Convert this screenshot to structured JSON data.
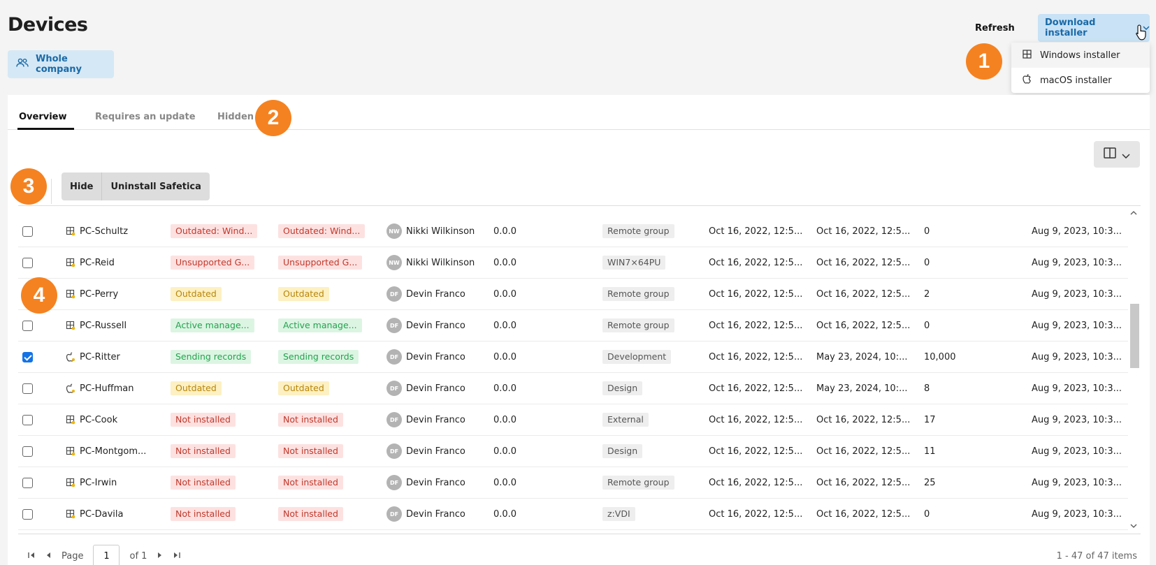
{
  "header": {
    "title": "Devices",
    "scope_label": "Whole company",
    "refresh_label": "Refresh",
    "download_label": "Download installer"
  },
  "download_menu": [
    {
      "label": "Windows installer",
      "icon": "windows-icon"
    },
    {
      "label": "macOS installer",
      "icon": "apple-icon"
    }
  ],
  "markers": [
    "1",
    "2",
    "3",
    "4"
  ],
  "tabs": [
    {
      "label": "Overview",
      "active": true
    },
    {
      "label": "Requires an update",
      "active": false
    },
    {
      "label": "Hidden",
      "active": false
    }
  ],
  "bulk_actions": {
    "hide_label": "Hide",
    "uninstall_label": "Uninstall Safetica"
  },
  "rows": [
    {
      "checked": false,
      "os": "windows",
      "name": "PC-Schultz",
      "status1": "Outdated: Wind...",
      "status2": "Outdated: Wind...",
      "status_color": "red",
      "user_initials": "NW",
      "user": "Nikki Wilkinson",
      "version": "0.0.0",
      "group": "Remote group",
      "date1": "Oct 16, 2022, 12:5...",
      "date2": "Oct 16, 2022, 12:5...",
      "count": "0",
      "date3": "Aug 9, 2023, 10:3..."
    },
    {
      "checked": false,
      "os": "windows",
      "name": "PC-Reid",
      "status1": "Unsupported G...",
      "status2": "Unsupported G...",
      "status_color": "red",
      "user_initials": "NW",
      "user": "Nikki Wilkinson",
      "version": "0.0.0",
      "group": "WIN7×64PU",
      "date1": "Oct 16, 2022, 12:5...",
      "date2": "Oct 16, 2022, 12:5...",
      "count": "0",
      "date3": "Aug 9, 2023, 10:3..."
    },
    {
      "checked": false,
      "os": "windows",
      "name": "PC-Perry",
      "status1": "Outdated",
      "status2": "Outdated",
      "status_color": "yellow",
      "user_initials": "DF",
      "user": "Devin Franco",
      "version": "0.0.0",
      "group": "Remote group",
      "date1": "Oct 16, 2022, 12:5...",
      "date2": "Oct 16, 2022, 12:5...",
      "count": "2",
      "date3": "Aug 9, 2023, 10:3..."
    },
    {
      "checked": false,
      "os": "windows",
      "name": "PC-Russell",
      "status1": "Active manage...",
      "status2": "Active manage...",
      "status_color": "green",
      "user_initials": "DF",
      "user": "Devin Franco",
      "version": "0.0.0",
      "group": "Remote group",
      "date1": "Oct 16, 2022, 12:5...",
      "date2": "Oct 16, 2022, 12:5...",
      "count": "0",
      "date3": "Aug 9, 2023, 10:3..."
    },
    {
      "checked": true,
      "os": "mac",
      "name": "PC-Ritter",
      "status1": "Sending records",
      "status2": "Sending records",
      "status_color": "green",
      "user_initials": "DF",
      "user": "Devin Franco",
      "version": "0.0.0",
      "group": "Development",
      "date1": "Oct 16, 2022, 12:5...",
      "date2": "May 23, 2024, 10:...",
      "count": "10,000",
      "date3": "Aug 9, 2023, 10:3..."
    },
    {
      "checked": false,
      "os": "mac",
      "name": "PC-Huffman",
      "status1": "Outdated",
      "status2": "Outdated",
      "status_color": "yellow",
      "user_initials": "DF",
      "user": "Devin Franco",
      "version": "0.0.0",
      "group": "Design",
      "date1": "Oct 16, 2022, 12:5...",
      "date2": "May 23, 2024, 10:...",
      "count": "8",
      "date3": "Aug 9, 2023, 10:3..."
    },
    {
      "checked": false,
      "os": "windows",
      "name": "PC-Cook",
      "status1": "Not installed",
      "status2": "Not installed",
      "status_color": "red",
      "user_initials": "DF",
      "user": "Devin Franco",
      "version": "0.0.0",
      "group": "External",
      "date1": "Oct 16, 2022, 12:5...",
      "date2": "Oct 16, 2022, 12:5...",
      "count": "17",
      "date3": "Aug 9, 2023, 10:3..."
    },
    {
      "checked": false,
      "os": "windows",
      "name": "PC-Montgom...",
      "status1": "Not installed",
      "status2": "Not installed",
      "status_color": "red",
      "user_initials": "DF",
      "user": "Devin Franco",
      "version": "0.0.0",
      "group": "Design",
      "date1": "Oct 16, 2022, 12:5...",
      "date2": "Oct 16, 2022, 12:5...",
      "count": "11",
      "date3": "Aug 9, 2023, 10:3..."
    },
    {
      "checked": false,
      "os": "windows",
      "name": "PC-Irwin",
      "status1": "Not installed",
      "status2": "Not installed",
      "status_color": "red",
      "user_initials": "DF",
      "user": "Devin Franco",
      "version": "0.0.0",
      "group": "Remote group",
      "date1": "Oct 16, 2022, 12:5...",
      "date2": "Oct 16, 2022, 12:5...",
      "count": "25",
      "date3": "Aug 9, 2023, 10:3..."
    },
    {
      "checked": false,
      "os": "windows",
      "name": "PC-Davila",
      "status1": "Not installed",
      "status2": "Not installed",
      "status_color": "red",
      "user_initials": "DF",
      "user": "Devin Franco",
      "version": "0.0.0",
      "group": "z:VDI",
      "date1": "Oct 16, 2022, 12:5...",
      "date2": "Oct 16, 2022, 12:5...",
      "count": "0",
      "date3": "Aug 9, 2023, 10:3..."
    }
  ],
  "pagination": {
    "page_label": "Page",
    "current_page": "1",
    "of_label": "of 1",
    "items_summary": "1 - 47 of 47 items"
  },
  "colors": {
    "accent": "#1a6aa8",
    "marker": "#f58220",
    "checkbox_checked": "#1473e6"
  }
}
